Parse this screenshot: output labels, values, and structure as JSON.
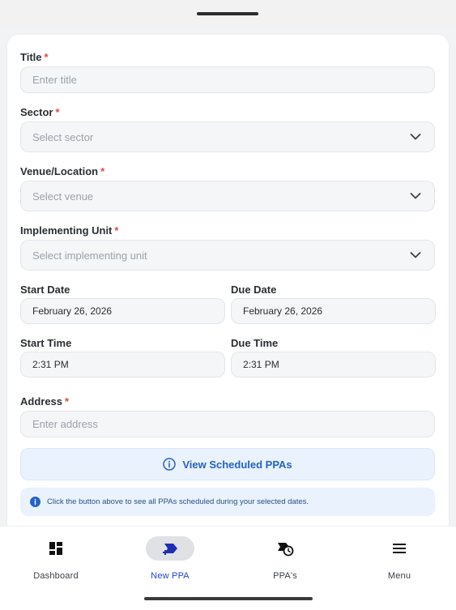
{
  "form": {
    "title_label": "Title",
    "title_placeholder": "Enter title",
    "sector_label": "Sector",
    "sector_placeholder": "Select sector",
    "venue_label": "Venue/Location",
    "venue_placeholder": "Select venue",
    "unit_label": "Implementing Unit",
    "unit_placeholder": "Select implementing unit",
    "start_date_label": "Start Date",
    "start_date_value": "February 26, 2026",
    "due_date_label": "Due Date",
    "due_date_value": "February 26, 2026",
    "start_time_label": "Start Time",
    "start_time_value": "2:31 PM",
    "due_time_label": "Due Time",
    "due_time_value": "2:31 PM",
    "address_label": "Address",
    "address_placeholder": "Enter address",
    "required_mark": "*"
  },
  "view_button": {
    "label": "View Scheduled PPAs",
    "icon": "info-circle-icon"
  },
  "info_note": {
    "text": "Click the button above to see all PPAs scheduled during your selected dates.",
    "icon": "info-filled-icon"
  },
  "nav": {
    "items": [
      {
        "label": "Dashboard",
        "icon": "dashboard-grid-icon",
        "active": false
      },
      {
        "label": "New PPA",
        "icon": "new-ppa-icon",
        "active": true
      },
      {
        "label": "PPA's",
        "icon": "ppa-clock-icon",
        "active": false
      },
      {
        "label": "Menu",
        "icon": "hamburger-menu-icon",
        "active": false
      }
    ]
  },
  "colors": {
    "accent": "#2244d6",
    "link_blue": "#2563c4",
    "required": "#e04848",
    "info_bg": "#e9f2fd"
  }
}
